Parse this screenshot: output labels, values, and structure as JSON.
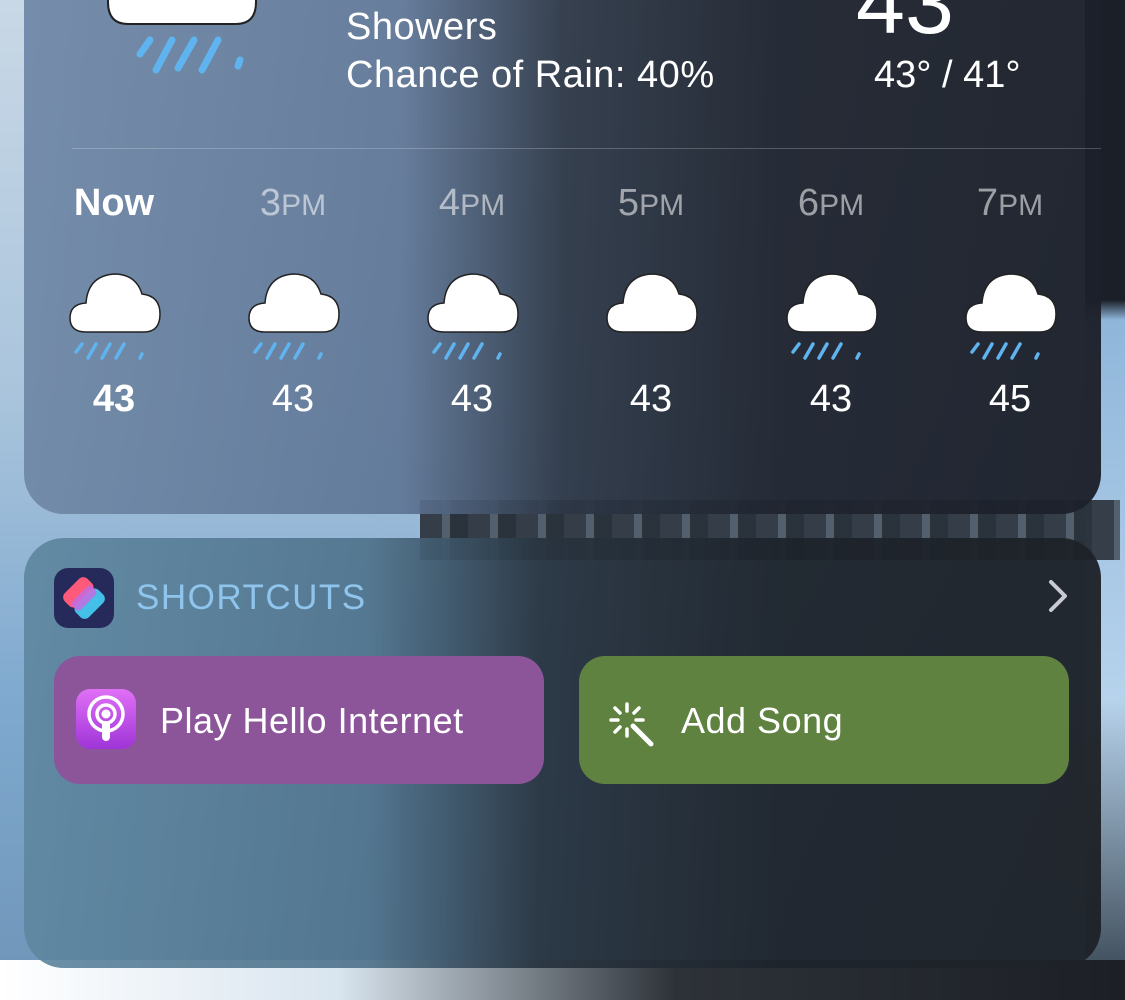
{
  "weather": {
    "condition": "Showers",
    "chance_of_rain": "Chance of Rain: 40%",
    "current_temp": "43",
    "high_low": "43° / 41°",
    "hours": [
      {
        "label": "Now",
        "temp": "43",
        "icon": "cloud-rain-icon",
        "now": true
      },
      {
        "label": "3",
        "ampm": "PM",
        "temp": "43",
        "icon": "cloud-rain-icon"
      },
      {
        "label": "4",
        "ampm": "PM",
        "temp": "43",
        "icon": "cloud-rain-icon"
      },
      {
        "label": "5",
        "ampm": "PM",
        "temp": "43",
        "icon": "cloud-icon"
      },
      {
        "label": "6",
        "ampm": "PM",
        "temp": "43",
        "icon": "cloud-rain-icon"
      },
      {
        "label": "7",
        "ampm": "PM",
        "temp": "45",
        "icon": "cloud-rain-icon"
      }
    ]
  },
  "shortcuts": {
    "title": "SHORTCUTS",
    "buttons": [
      {
        "label": "Play Hello Internet",
        "icon": "podcast-icon",
        "color": "#8c559a"
      },
      {
        "label": "Add Song",
        "icon": "magic-wand-icon",
        "color": "#5f8241"
      }
    ]
  },
  "colors": {
    "rain_drop": "#5fb4f0",
    "shortcuts_title": "#8fc4ec"
  }
}
